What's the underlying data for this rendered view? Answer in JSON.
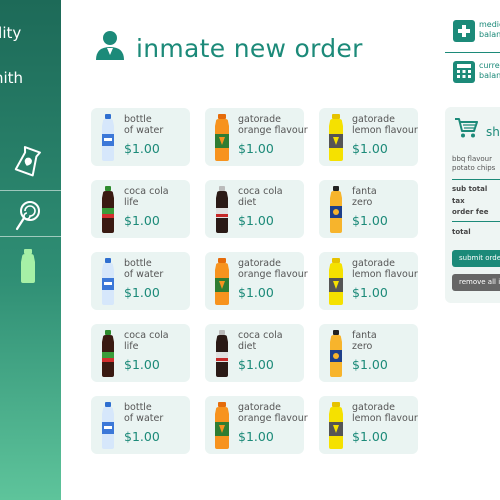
{
  "sidebar": {
    "line1": "ility",
    "line2": "nith",
    "icons": [
      "chips-bag-icon",
      "lollipop-icon",
      "bottle-icon"
    ]
  },
  "header": {
    "title": "inmate new order"
  },
  "info": {
    "medical": "medic\nbalan",
    "current": "curre\nbalan"
  },
  "products": [
    {
      "name": "bottle\nof water",
      "price": "$1.00",
      "kind": "water"
    },
    {
      "name": "gatorade\norange flavour",
      "price": "$1.00",
      "kind": "orange"
    },
    {
      "name": "gatorade\nlemon flavour",
      "price": "$1.00",
      "kind": "lemon"
    },
    {
      "name": "coca cola\nlife",
      "price": "$1.00",
      "kind": "cola-life"
    },
    {
      "name": "coca cola\ndiet",
      "price": "$1.00",
      "kind": "cola-diet"
    },
    {
      "name": "fanta\nzero",
      "price": "$1.00",
      "kind": "fanta"
    },
    {
      "name": "bottle\nof water",
      "price": "$1.00",
      "kind": "water"
    },
    {
      "name": "gatorade\norange flavour",
      "price": "$1.00",
      "kind": "orange"
    },
    {
      "name": "gatorade\nlemon flavour",
      "price": "$1.00",
      "kind": "lemon"
    },
    {
      "name": "coca cola\nlife",
      "price": "$1.00",
      "kind": "cola-life"
    },
    {
      "name": "coca cola\ndiet",
      "price": "$1.00",
      "kind": "cola-diet"
    },
    {
      "name": "fanta\nzero",
      "price": "$1.00",
      "kind": "fanta"
    },
    {
      "name": "bottle\nof water",
      "price": "$1.00",
      "kind": "water"
    },
    {
      "name": "gatorade\norange flavour",
      "price": "$1.00",
      "kind": "orange"
    },
    {
      "name": "gatorade\nlemon flavour",
      "price": "$1.00",
      "kind": "lemon"
    }
  ],
  "cart": {
    "title": "sh",
    "item": "bbq flavour\npotato chips",
    "subtotal_label": "sub total",
    "tax_label": "tax",
    "order_fee_label": "order fee",
    "total_label": "total",
    "submit_label": "submit orde",
    "remove_label": "remove all it"
  },
  "colors": {
    "accent": "#1c8a79",
    "sidebar_top": "#1d6a58",
    "sidebar_bottom": "#5ec49b",
    "card_bg": "#eaf4f2"
  }
}
